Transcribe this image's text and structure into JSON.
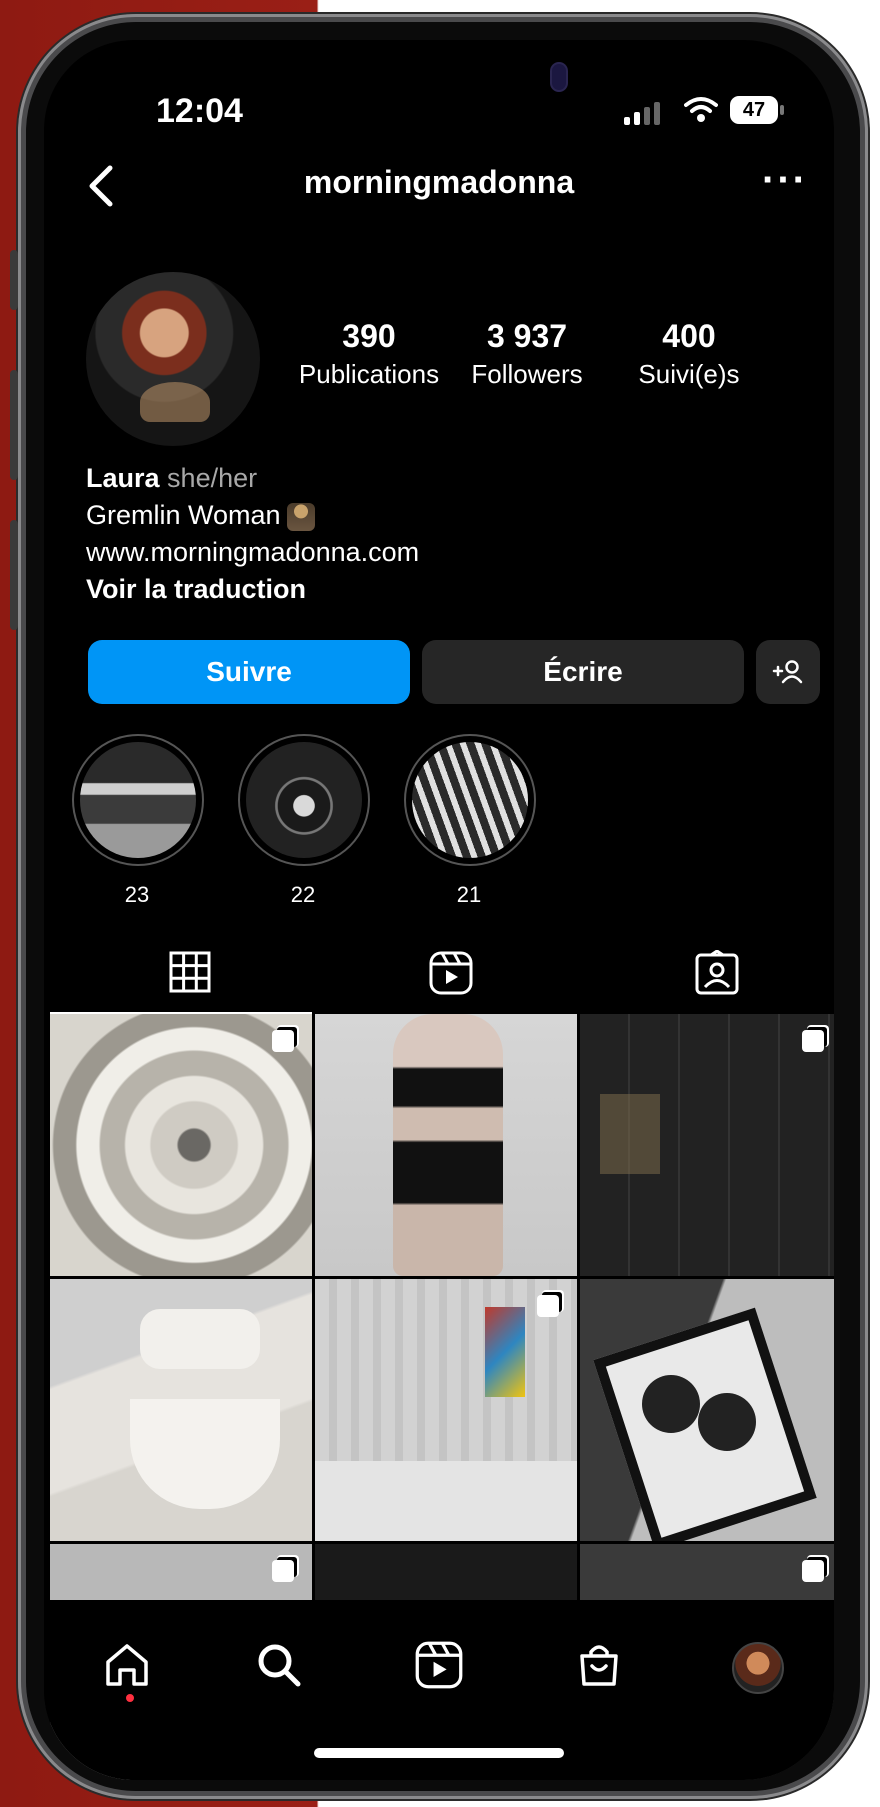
{
  "status_bar": {
    "time": "12:04",
    "battery": "47"
  },
  "header": {
    "username": "morningmadonna"
  },
  "stats": [
    {
      "num": "390",
      "label": "Publications"
    },
    {
      "num": "3 937",
      "label": "Followers"
    },
    {
      "num": "400",
      "label": "Suivi(e)s"
    }
  ],
  "bio": {
    "name": "Laura",
    "pronouns": "she/her",
    "line2": "Gremlin Woman",
    "website": "www.morningmadonna.com",
    "translate": "Voir la traduction"
  },
  "buttons": {
    "follow": "Suivre",
    "message": "Écrire"
  },
  "highlights": [
    {
      "label": "23"
    },
    {
      "label": "22"
    },
    {
      "label": "21"
    }
  ],
  "colors": {
    "accent": "#0095f6",
    "button_dark": "#262626",
    "notification": "#ff3040",
    "background": "#000000"
  },
  "icons": {
    "tabs": [
      "grid-icon",
      "reels-icon",
      "tagged-icon"
    ],
    "nav": [
      "home-icon",
      "search-icon",
      "reels-icon",
      "shop-icon",
      "profile-avatar"
    ]
  }
}
